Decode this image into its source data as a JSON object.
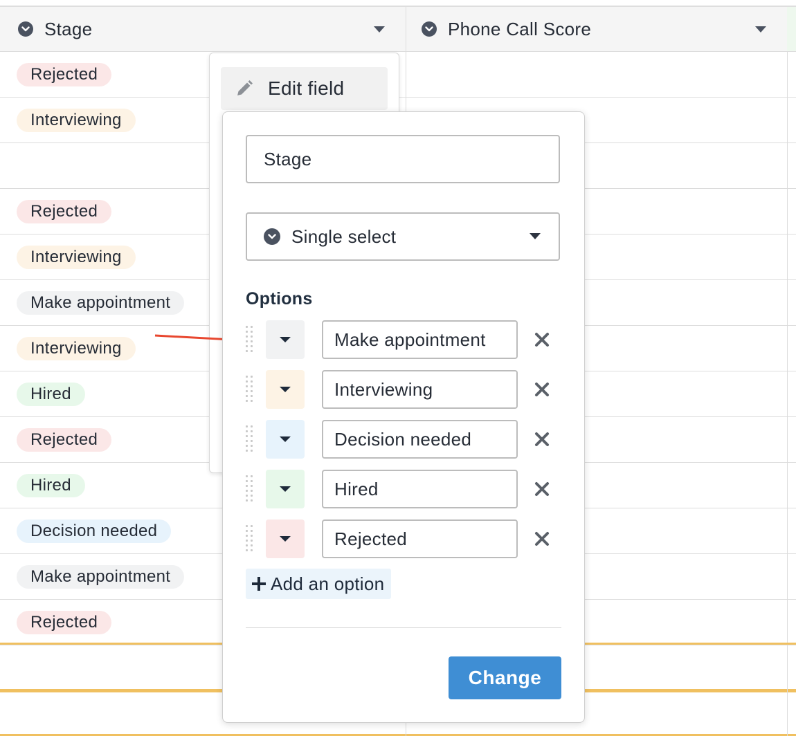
{
  "grid": {
    "columns": [
      {
        "label": "Stage",
        "icon": "select-circle-icon"
      },
      {
        "label": "Phone Call Score",
        "icon": "select-circle-icon"
      }
    ],
    "rows": [
      {
        "stage": "Rejected",
        "color": "#fbe7e7"
      },
      {
        "stage": "Interviewing",
        "color": "#fdf3e5"
      },
      {
        "stage": "",
        "color": ""
      },
      {
        "stage": "Rejected",
        "color": "#fbe7e7"
      },
      {
        "stage": "Interviewing",
        "color": "#fdf3e5"
      },
      {
        "stage": "Make appointment",
        "color": "#f1f2f3"
      },
      {
        "stage": "Interviewing",
        "color": "#fdf3e5"
      },
      {
        "stage": "Hired",
        "color": "#e7f8ea"
      },
      {
        "stage": "Rejected",
        "color": "#fbe7e7"
      },
      {
        "stage": "Hired",
        "color": "#e7f8ea"
      },
      {
        "stage": "Decision needed",
        "color": "#e7f3fc"
      },
      {
        "stage": "Make appointment",
        "color": "#f1f2f3"
      },
      {
        "stage": "Rejected",
        "color": "#fbe7e7"
      }
    ]
  },
  "context_menu": {
    "edit_field_label": "Edit field",
    "edit_icon": "pencil-icon"
  },
  "edit_panel": {
    "field_name": "Stage",
    "field_type": "Single select",
    "options_title": "Options",
    "options": [
      {
        "label": "Make appointment",
        "color": "#f1f2f3"
      },
      {
        "label": "Interviewing",
        "color": "#fdf3e5"
      },
      {
        "label": "Decision needed",
        "color": "#e7f3fc"
      },
      {
        "label": "Hired",
        "color": "#e7f8ea"
      },
      {
        "label": "Rejected",
        "color": "#fbe7e7"
      }
    ],
    "add_option_label": "Add an option",
    "submit_label": "Change"
  },
  "annotation": {
    "arrow_color": "#e8472f"
  }
}
